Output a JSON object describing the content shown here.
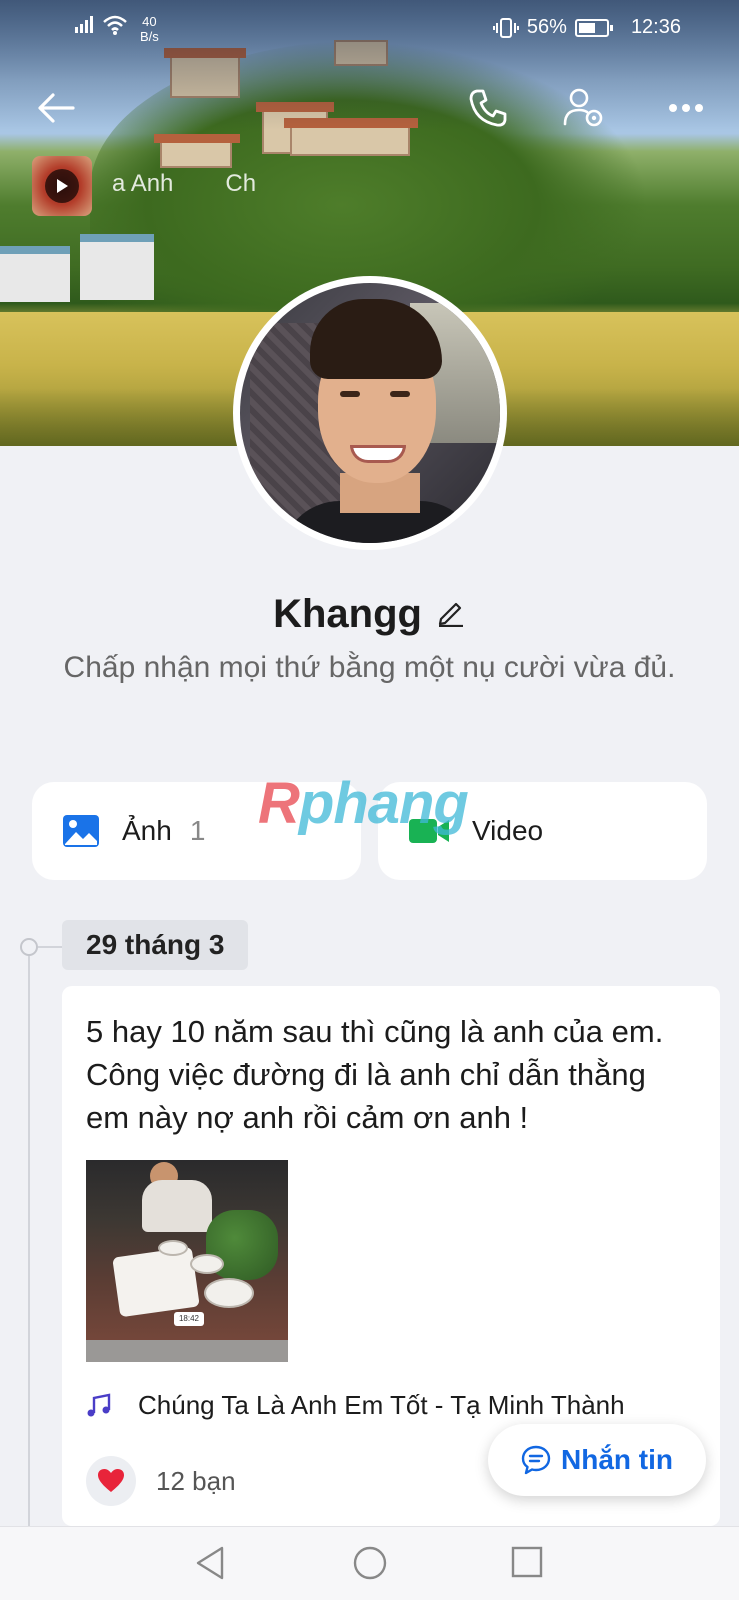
{
  "status_bar": {
    "net_speed_value": "40",
    "net_speed_unit": "B/s",
    "battery_percent": "56%",
    "time": "12:36"
  },
  "cover": {
    "music_ticker": [
      "a Anh",
      "Ch"
    ]
  },
  "profile": {
    "name": "Khangg",
    "bio": "Chấp nhận mọi thứ bằng một nụ cười vừa đủ."
  },
  "media": {
    "photos_label": "Ảnh",
    "photos_count": "1",
    "video_label": "Video"
  },
  "watermark": {
    "first_letter": "R",
    "rest": "phang"
  },
  "timeline": {
    "date": "29 tháng 3"
  },
  "post": {
    "text": "5 hay 10 năm sau thì cũng là anh của em. Công việc đường đi là anh chỉ dẫn thằng em này nợ anh rồi cảm ơn anh !",
    "photo_timestamp": "18:42",
    "music": "Chúng Ta Là Anh Em Tốt - Tạ Minh Thành",
    "likes": "12 bạn"
  },
  "fab": {
    "label": "Nhắn tin"
  },
  "colors": {
    "accent_blue": "#1167e2",
    "video_green": "#19b254",
    "photo_blue": "#1a73e8",
    "heart_red": "#e8243a",
    "music_purple": "#4a3dc7"
  },
  "icons": {
    "back": "arrow-left-icon",
    "call": "phone-icon",
    "settings": "user-settings-icon",
    "more": "more-horizontal-icon",
    "edit": "pencil-icon",
    "photo": "image-icon",
    "video": "video-camera-icon",
    "music": "music-note-icon",
    "heart": "heart-icon",
    "chat": "chat-bubble-icon"
  }
}
